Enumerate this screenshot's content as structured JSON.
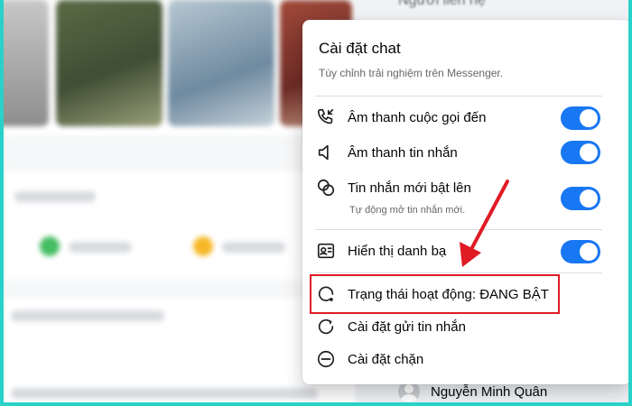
{
  "background": {
    "contacts_title": "Người liên hệ",
    "contact": {
      "name": "Nguyễn Minh Quân"
    }
  },
  "chat_settings": {
    "title": "Cài đặt chat",
    "subtitle": "Tùy chỉnh trải nghiệm trên Messenger.",
    "items": [
      {
        "label": "Âm thanh cuộc gọi đến",
        "icon": "incoming-call-icon",
        "toggle": true
      },
      {
        "label": "Âm thanh tin nhắn",
        "icon": "speaker-icon",
        "toggle": true
      },
      {
        "label": "Tin nhắn mới bật lên",
        "icon": "chat-bubbles-icon",
        "toggle": true,
        "hint": "Tự động mở tin nhắn mới."
      },
      {
        "label": "Hiển thị danh bạ",
        "icon": "contact-card-icon",
        "toggle": true
      },
      {
        "label": "Trạng thái hoạt động: ĐANG BẬT",
        "icon": "active-status-icon"
      },
      {
        "label": "Cài đặt gửi tin nhắn",
        "icon": "send-settings-icon"
      },
      {
        "label": "Cài đặt chặn",
        "icon": "block-icon"
      }
    ]
  },
  "colors": {
    "accent": "#1877f2",
    "highlight": "#e01b24",
    "frame": "#2ad1c9"
  }
}
